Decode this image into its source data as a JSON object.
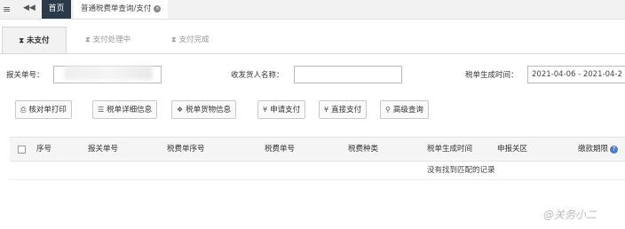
{
  "topbar": {
    "menu_icon": "hamburger-icon",
    "back_icon": "double-left-arrow-icon",
    "tabs": [
      {
        "label": "首页"
      },
      {
        "label": "普通税费单查询/支付"
      }
    ]
  },
  "status_tabs": [
    {
      "label": "未支付",
      "icon": "hourglass-icon"
    },
    {
      "label": "支付处理中",
      "icon": "hourglass-icon"
    },
    {
      "label": "支付完成",
      "icon": "hourglass-icon"
    }
  ],
  "search": {
    "declaration_no_label": "报关单号：",
    "declaration_no_value": "",
    "consignee_label": "收发货人名称：",
    "consignee_value": "",
    "date_label": "税单生成时间：",
    "date_value": "2021-04-06 - 2021-04-2"
  },
  "actions": [
    {
      "label": "核对单打印",
      "icon": "print-icon"
    },
    {
      "label": "税单详细信息",
      "icon": "list-icon"
    },
    {
      "label": "税单货物信息",
      "icon": "cubes-icon"
    },
    {
      "label": "申请支付",
      "icon": "yen-icon"
    },
    {
      "label": "直接支付",
      "icon": "yen-icon"
    },
    {
      "label": "高级查询",
      "icon": "search-icon"
    }
  ],
  "table": {
    "columns": [
      "序号",
      "报关单号",
      "税费单序号",
      "税费单号",
      "税费种类",
      "税单生成时间",
      "申报关区",
      "缴款期限"
    ],
    "empty_message": "没有找到匹配的记录"
  },
  "watermark": "@关务小二",
  "colors": {
    "home_tab_bg": "#2b3a4a",
    "help_icon": "#4a7bc8"
  }
}
